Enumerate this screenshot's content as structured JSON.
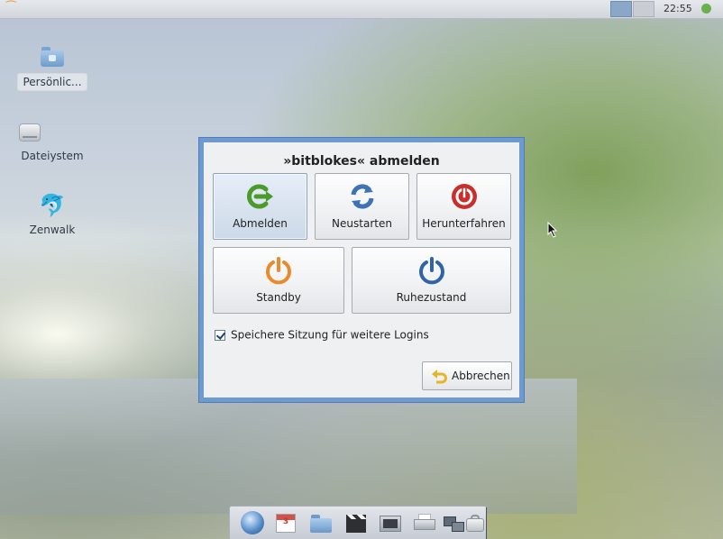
{
  "top_panel": {
    "clock": "22:55",
    "menu_icon": "zenwalk-logo-icon",
    "workspaces": [
      "workspace-1",
      "workspace-2"
    ],
    "active_workspace": 1,
    "network_icon": "network-status-icon"
  },
  "desktop": {
    "icons": [
      {
        "label": "Persönlic...",
        "icon": "home-folder-icon",
        "selected": true
      },
      {
        "label": "Dateiystem",
        "icon": "drive-icon"
      },
      {
        "label": "Zenwalk",
        "icon": "zenwalk-icon"
      }
    ]
  },
  "dialog": {
    "title": "»bitblokes« abmelden",
    "buttons": {
      "logout": {
        "label": "Abmelden",
        "icon": "logout-arrow-icon",
        "color": "#4a9a2c"
      },
      "restart": {
        "label": "Neustarten",
        "icon": "restart-icon",
        "color": "#3f72b5"
      },
      "shutdown": {
        "label": "Herunterfahren",
        "icon": "shutdown-icon",
        "color": "#c9302c"
      },
      "standby": {
        "label": "Standby",
        "icon": "standby-power-icon",
        "color": "#ea8a2b"
      },
      "hibernate": {
        "label": "Ruhezustand",
        "icon": "hibernate-power-icon",
        "color": "#2f64a8"
      }
    },
    "save_session": {
      "label": "Speichere Sitzung für weitere Logins",
      "checked": true
    },
    "cancel": {
      "label": "Abbrechen",
      "icon": "undo-arrow-icon"
    }
  },
  "dock": {
    "items": [
      {
        "icon": "web-browser-icon"
      },
      {
        "icon": "calendar-icon",
        "text": "3"
      },
      {
        "icon": "folder-icon"
      },
      {
        "icon": "media-clapper-icon"
      },
      {
        "icon": "terminal-icon"
      },
      {
        "icon": "printer-icon"
      },
      {
        "icon": "network-icon"
      },
      {
        "icon": "archive-icon"
      }
    ]
  }
}
